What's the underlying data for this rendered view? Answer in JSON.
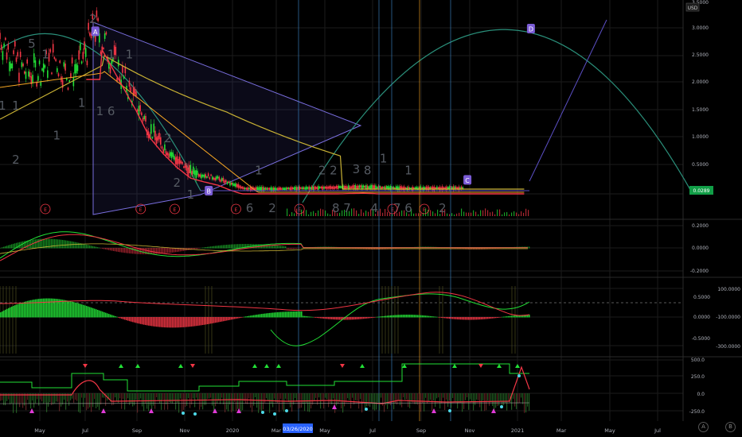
{
  "currency_label": "USD",
  "current_price_label": "0.0289",
  "cursor_date": "03/26/2020",
  "corner_buttons": [
    "A",
    "B"
  ],
  "colors": {
    "up": "#22e036",
    "down": "#f23645",
    "ma_yellow": "#c9b234",
    "ma_orange": "#f5a623",
    "cycle_teal": "#2a8f7a",
    "wedge": "#5b4fc4",
    "badge": "#7b5cd6",
    "crosshair": "#3d86c6",
    "grid": "#1b1b1b"
  },
  "chart_data": [
    {
      "type": "line",
      "name": "price",
      "ylim": [
        0,
        3.5
      ],
      "y_ticks": [
        "3.5000",
        "3.0000",
        "2.5000",
        "2.0000",
        "1.5000",
        "1.0000",
        "0.5000"
      ],
      "x_ticks": [
        "May",
        "Jul",
        "Sep",
        "Nov",
        "2020",
        "Mar",
        "May",
        "Jul",
        "Sep",
        "Nov",
        "2021",
        "Mar",
        "May",
        "Jul"
      ],
      "price_path": [
        [
          0,
          2.8
        ],
        [
          0.3,
          2.4
        ],
        [
          0.6,
          2.1
        ],
        [
          0.9,
          2.2
        ],
        [
          1.2,
          2.4
        ],
        [
          1.5,
          2.05
        ],
        [
          1.8,
          2.35
        ],
        [
          2.1,
          2.95
        ],
        [
          2.4,
          2.5
        ],
        [
          2.7,
          2.05
        ],
        [
          3.0,
          1.6
        ],
        [
          3.3,
          1.1
        ],
        [
          3.6,
          0.8
        ],
        [
          3.9,
          0.55
        ],
        [
          4.2,
          0.35
        ],
        [
          4.5,
          0.28
        ],
        [
          4.8,
          0.22
        ],
        [
          5.1,
          0.12
        ],
        [
          5.4,
          0.04
        ],
        [
          6,
          0.03
        ],
        [
          7,
          0.05
        ],
        [
          8,
          0.07
        ],
        [
          9,
          0.04
        ],
        [
          10.2,
          0.05
        ]
      ],
      "waves": [
        {
          "label": "A",
          "x": 2.1,
          "y": 2.95
        },
        {
          "label": "B",
          "x": 4.6,
          "y": 0
        },
        {
          "label": "C",
          "x": 10.3,
          "y": 0.2
        },
        {
          "label": "D",
          "x": 11.7,
          "y": 3.0
        }
      ],
      "count_labels": [
        {
          "t": "2",
          "x": 2.05,
          "y": 3.1
        },
        {
          "t": "5",
          "x": 0.7,
          "y": 2.65
        },
        {
          "t": "1",
          "x": 1.0,
          "y": 2.45
        },
        {
          "t": "1",
          "x": 2.45,
          "y": 2.45
        },
        {
          "t": "1",
          "x": 2.85,
          "y": 2.45
        },
        {
          "t": "1",
          "x": 0.05,
          "y": 1.5
        },
        {
          "t": "1",
          "x": 0.35,
          "y": 1.5
        },
        {
          "t": "1",
          "x": 1.8,
          "y": 1.55
        },
        {
          "t": "1",
          "x": 2.2,
          "y": 1.4
        },
        {
          "t": "6",
          "x": 2.45,
          "y": 1.4
        },
        {
          "t": "1",
          "x": 1.25,
          "y": 0.95
        },
        {
          "t": "2",
          "x": 0.35,
          "y": 0.5
        },
        {
          "t": "2",
          "x": 3.7,
          "y": 0.9
        },
        {
          "t": "2",
          "x": 3.9,
          "y": 0.07
        },
        {
          "t": "1",
          "x": 4.2,
          "y": -0.15
        },
        {
          "t": "1",
          "x": 5.7,
          "y": 0.3
        },
        {
          "t": "2",
          "x": 7.1,
          "y": 0.3
        },
        {
          "t": "2",
          "x": 7.35,
          "y": 0.3
        },
        {
          "t": "3",
          "x": 7.85,
          "y": 0.32
        },
        {
          "t": "8",
          "x": 8.1,
          "y": 0.3
        },
        {
          "t": "1",
          "x": 8.45,
          "y": 0.52
        },
        {
          "t": "1",
          "x": 9.0,
          "y": 0.3
        },
        {
          "t": "6",
          "x": 5.5,
          "y": -0.4
        },
        {
          "t": "2",
          "x": 6.0,
          "y": -0.4
        },
        {
          "t": "8",
          "x": 7.4,
          "y": -0.4
        },
        {
          "t": "7",
          "x": 7.65,
          "y": -0.4
        },
        {
          "t": "4",
          "x": 8.25,
          "y": -0.4
        },
        {
          "t": "7",
          "x": 8.75,
          "y": -0.4
        },
        {
          "t": "6",
          "x": 9.0,
          "y": -0.4
        },
        {
          "t": "2",
          "x": 9.75,
          "y": -0.4
        }
      ],
      "earnings_markers": [
        1.0,
        3.1,
        3.85,
        5.2,
        6.6,
        8.65,
        9.35
      ]
    },
    {
      "type": "line",
      "name": "oscillator",
      "y_ticks": [
        "0.2000",
        "0.0000",
        "-0.2000"
      ]
    },
    {
      "type": "bar",
      "name": "momentum",
      "y_ticks_right": [
        "100.0000",
        "-100.0000",
        "-300.0000"
      ],
      "y_ticks_left": [
        "0.5000",
        "0.0000",
        "-0.5000"
      ]
    },
    {
      "type": "bar",
      "name": "signals",
      "y_ticks": [
        "500.0",
        "250.0",
        "0.0",
        "-250.0"
      ]
    }
  ]
}
